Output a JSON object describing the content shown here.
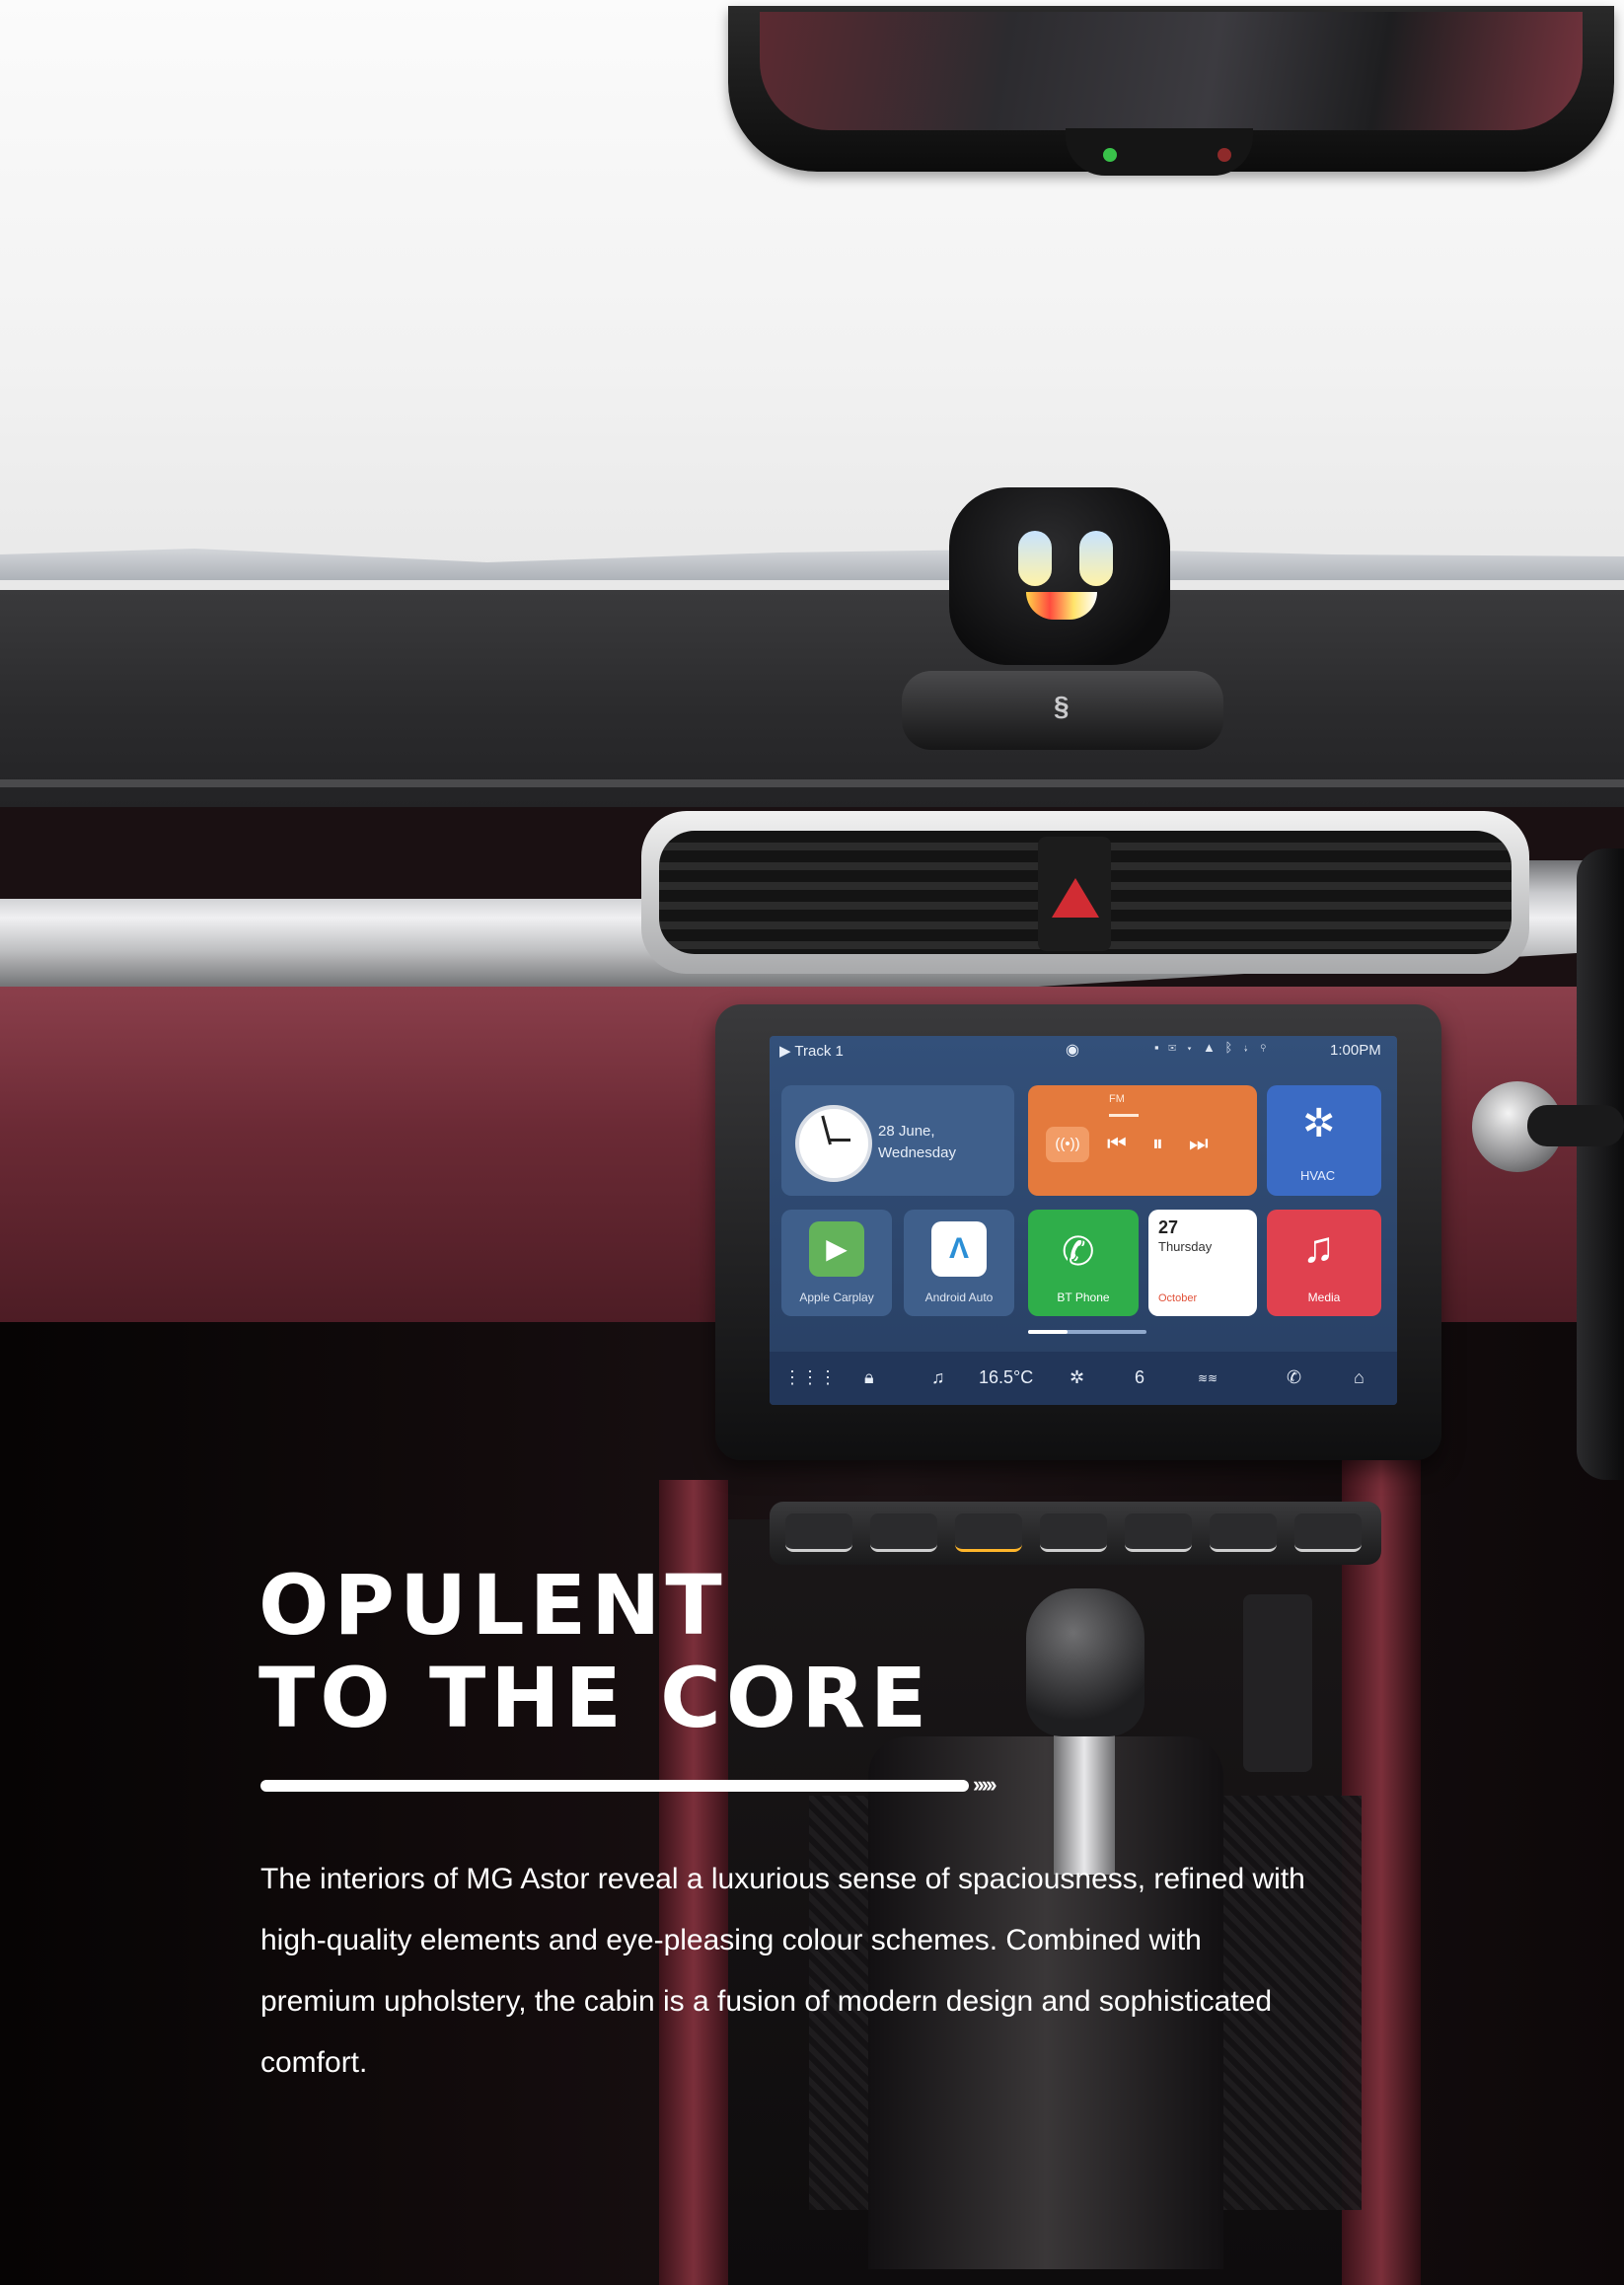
{
  "page": {
    "headline_line1": "OPULENT",
    "headline_line2": "TO THE CORE",
    "rule_arrows": "›››››",
    "body": "The interiors of MG Astor reveal a luxurious sense of spaciousness, refined with high-quality elements and eye-pleasing colour schemes. Combined with premium upholstery, the cabin is a fusion of modern design and sophisticated comfort."
  },
  "infotainment": {
    "status": {
      "track": "▶ Track 1",
      "time": "1:00PM",
      "icons": [
        "media-icon",
        "message-icon",
        "wifi-icon",
        "signal-icon",
        "bluetooth-icon",
        "usb-icon",
        "location-icon"
      ]
    },
    "date_tile": {
      "date": "28 June,",
      "weekday": "Wednesday"
    },
    "fm_tile": {
      "band": "FM"
    },
    "hvac_tile": {
      "label": "HVAC"
    },
    "apps": [
      {
        "label": "Apple Carplay"
      },
      {
        "label": "Android Auto"
      },
      {
        "label": "BT Phone"
      },
      {
        "label": "Media"
      }
    ],
    "calendar_tile": {
      "day": "27",
      "weekday": "Thursday",
      "month": "October"
    },
    "bottom_bar": {
      "temperature": "16.5°C",
      "fan": "6"
    }
  },
  "colors": {
    "screen_bg": "#2d4770",
    "fm_tile": "#e47a3d",
    "hvac_tile": "#3b6bc4",
    "phone_tile": "#2fae4a",
    "media_tile": "#e0414f",
    "leather": "#6b2a35"
  }
}
